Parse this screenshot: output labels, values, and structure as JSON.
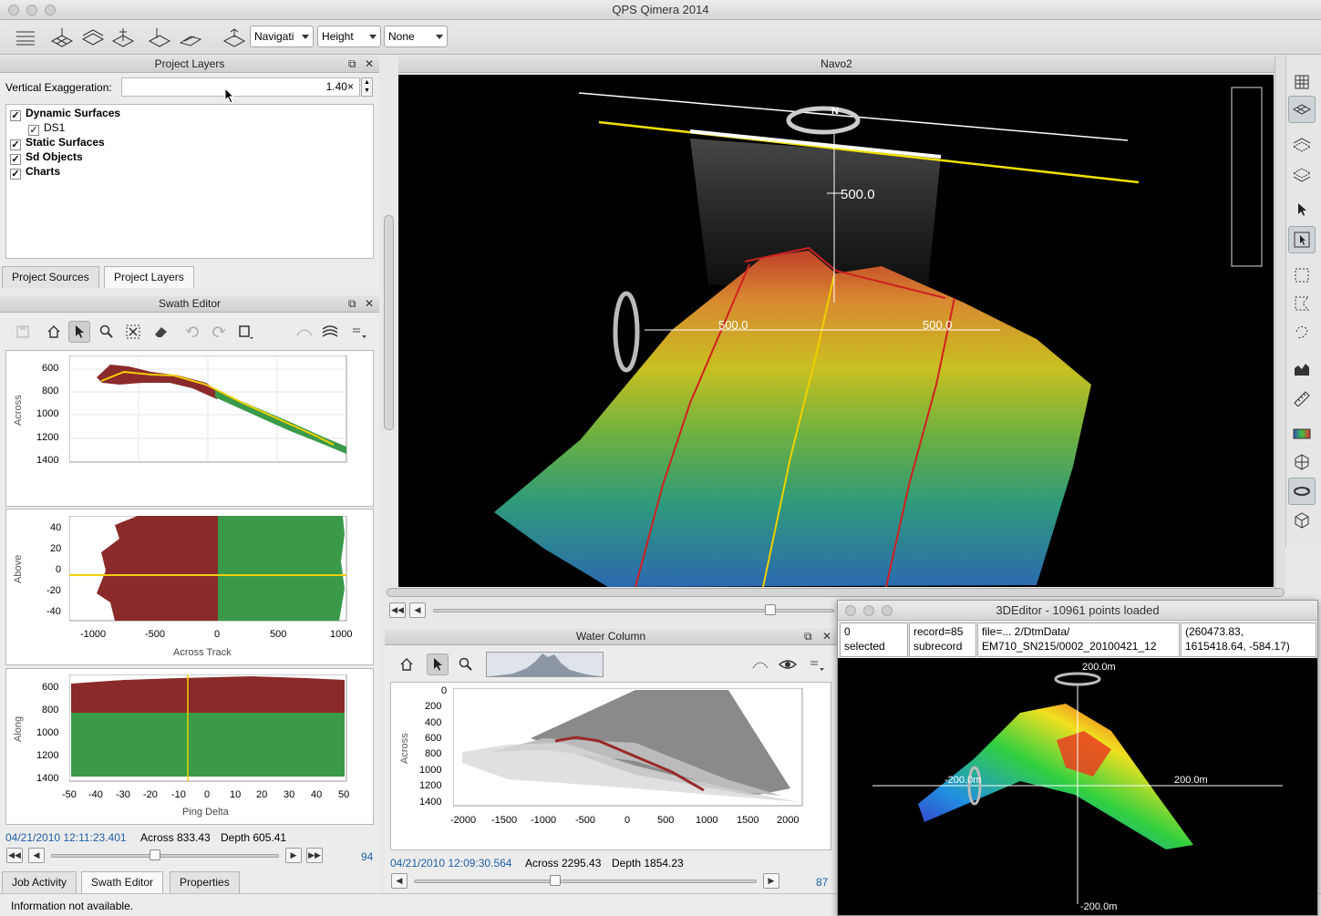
{
  "window": {
    "title": "QPS Qimera 2014"
  },
  "toolbar": {
    "combo_navigation": "Navigati",
    "combo_height": "Height",
    "combo_none": "None"
  },
  "project_layers": {
    "title": "Project Layers",
    "vert_exag_label": "Vertical Exaggeration:",
    "vert_exag_value": "1.40×",
    "layers": [
      {
        "label": "Dynamic Surfaces",
        "checked": "✓"
      },
      {
        "label": "DS1",
        "checked": "✓"
      },
      {
        "label": "Static Surfaces",
        "checked": "✓"
      },
      {
        "label": "Sd Objects",
        "checked": "✓"
      },
      {
        "label": "Charts",
        "checked": "✓"
      }
    ],
    "tabs": [
      "Project Sources",
      "Project Layers"
    ]
  },
  "swath_editor": {
    "title": "Swath Editor",
    "plot1": {
      "ylabel": "Across",
      "yticks": [
        "600",
        "800",
        "1000",
        "1200",
        "1400"
      ]
    },
    "plot2": {
      "ylabel": "Above",
      "xlabel": "Across Track",
      "yticks": [
        "40",
        "20",
        "0",
        "-20",
        "-40"
      ],
      "xticks": [
        "-1000",
        "-500",
        "0",
        "500",
        "1000"
      ]
    },
    "plot3": {
      "ylabel": "Along",
      "xlabel": "Ping Delta",
      "yticks": [
        "600",
        "800",
        "1000",
        "1200",
        "1400"
      ],
      "xticks": [
        "-50",
        "-40",
        "-30",
        "-20",
        "-10",
        "0",
        "10",
        "20",
        "30",
        "40",
        "50"
      ]
    },
    "timestamp": "04/21/2010 12:11:23.401",
    "across": "Across 833.43",
    "depth": "Depth 605.41",
    "ping": "94",
    "tabs": [
      "Job Activity",
      "Swath Editor",
      "Properties"
    ]
  },
  "navo2": {
    "title": "Navo2",
    "label_top": "500.0",
    "label_left": "500.0",
    "label_right": "500.0",
    "compass": "N"
  },
  "water_column": {
    "title": "Water Column",
    "ylabel": "Across",
    "yticks": [
      "0",
      "200",
      "400",
      "600",
      "800",
      "1000",
      "1200",
      "1400"
    ],
    "xticks": [
      "-2000",
      "-1500",
      "-1000",
      "-500",
      "0",
      "500",
      "1000",
      "1500",
      "2000"
    ],
    "timestamp": "04/21/2010 12:09:30.564",
    "across": "Across 2295.43",
    "depth": "Depth 1854.23",
    "ping": "87"
  },
  "editor3d": {
    "title": "3DEditor - 10961 points loaded",
    "cell_selected": [
      "0",
      "selected"
    ],
    "cell_record": [
      "record=85",
      "subrecord"
    ],
    "cell_file": [
      "file=... 2/DtmData/",
      "EM710_SN215/0002_20100421_12"
    ],
    "cell_coords": [
      "(260473.83,",
      "1615418.64, -584.17)"
    ],
    "label_top": "200.0m",
    "label_left": "-200.0m",
    "label_right": "200.0m",
    "label_bottom": "-200.0m"
  },
  "status": {
    "message": "Information not available."
  }
}
